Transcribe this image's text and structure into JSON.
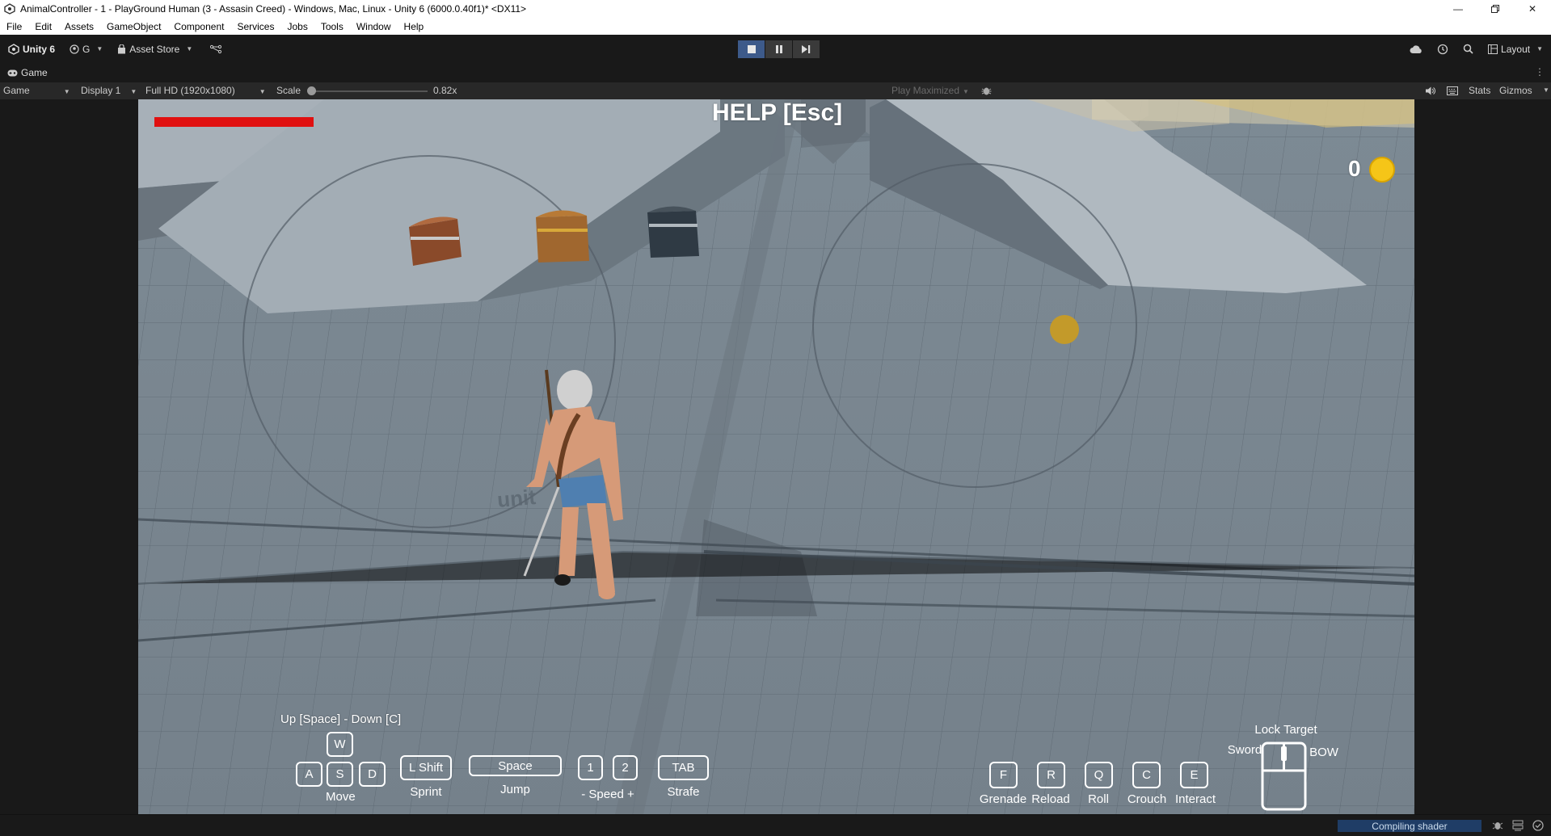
{
  "window": {
    "title": "AnimalController - 1 - PlayGround Human (3 - Assasin Creed) - Windows, Mac, Linux - Unity 6 (6000.0.40f1)* <DX11>",
    "minimize_icon": "minimize-icon",
    "maximize_icon": "restore-icon",
    "close_icon": "close-icon"
  },
  "menu": [
    "File",
    "Edit",
    "Assets",
    "GameObject",
    "Component",
    "Services",
    "Jobs",
    "Tools",
    "Window",
    "Help"
  ],
  "toolbar": {
    "unity_label": "Unity 6",
    "account_label": "G",
    "asset_store_label": "Asset Store",
    "layout_label": "Layout"
  },
  "tab": {
    "label": "Game"
  },
  "game_toolbar": {
    "mode": "Game",
    "display": "Display 1",
    "resolution": "Full HD (1920x1080)",
    "scale_label": "Scale",
    "scale_value": "0.82x",
    "play_mode": "Play Maximized",
    "stats": "Stats",
    "gizmos": "Gizmos"
  },
  "hud": {
    "help": "HELP [Esc]",
    "coins": "0",
    "health_fraction": 1.0,
    "vertical_hint": "Up [Space] - Down [C]",
    "keys": {
      "w": "W",
      "a": "A",
      "s": "S",
      "d": "D",
      "shift": "L Shift",
      "space": "Space",
      "one": "1",
      "two": "2",
      "tab": "TAB",
      "f": "F",
      "r": "R",
      "q": "Q",
      "c": "C",
      "e": "E"
    },
    "labels": {
      "move": "Move",
      "sprint": "Sprint",
      "jump": "Jump",
      "speed": "- Speed +",
      "strafe": "Strafe",
      "grenade": "Grenade",
      "reload": "Reload",
      "roll": "Roll",
      "crouch": "Crouch",
      "interact": "Interact",
      "lock_target": "Lock Target",
      "sword": "Sword",
      "bow": "BOW"
    }
  },
  "status": {
    "progress_text": "Compiling shader"
  },
  "colors": {
    "health": "#e01010",
    "coin": "#f5c518",
    "accent": "#3d5a8a"
  }
}
